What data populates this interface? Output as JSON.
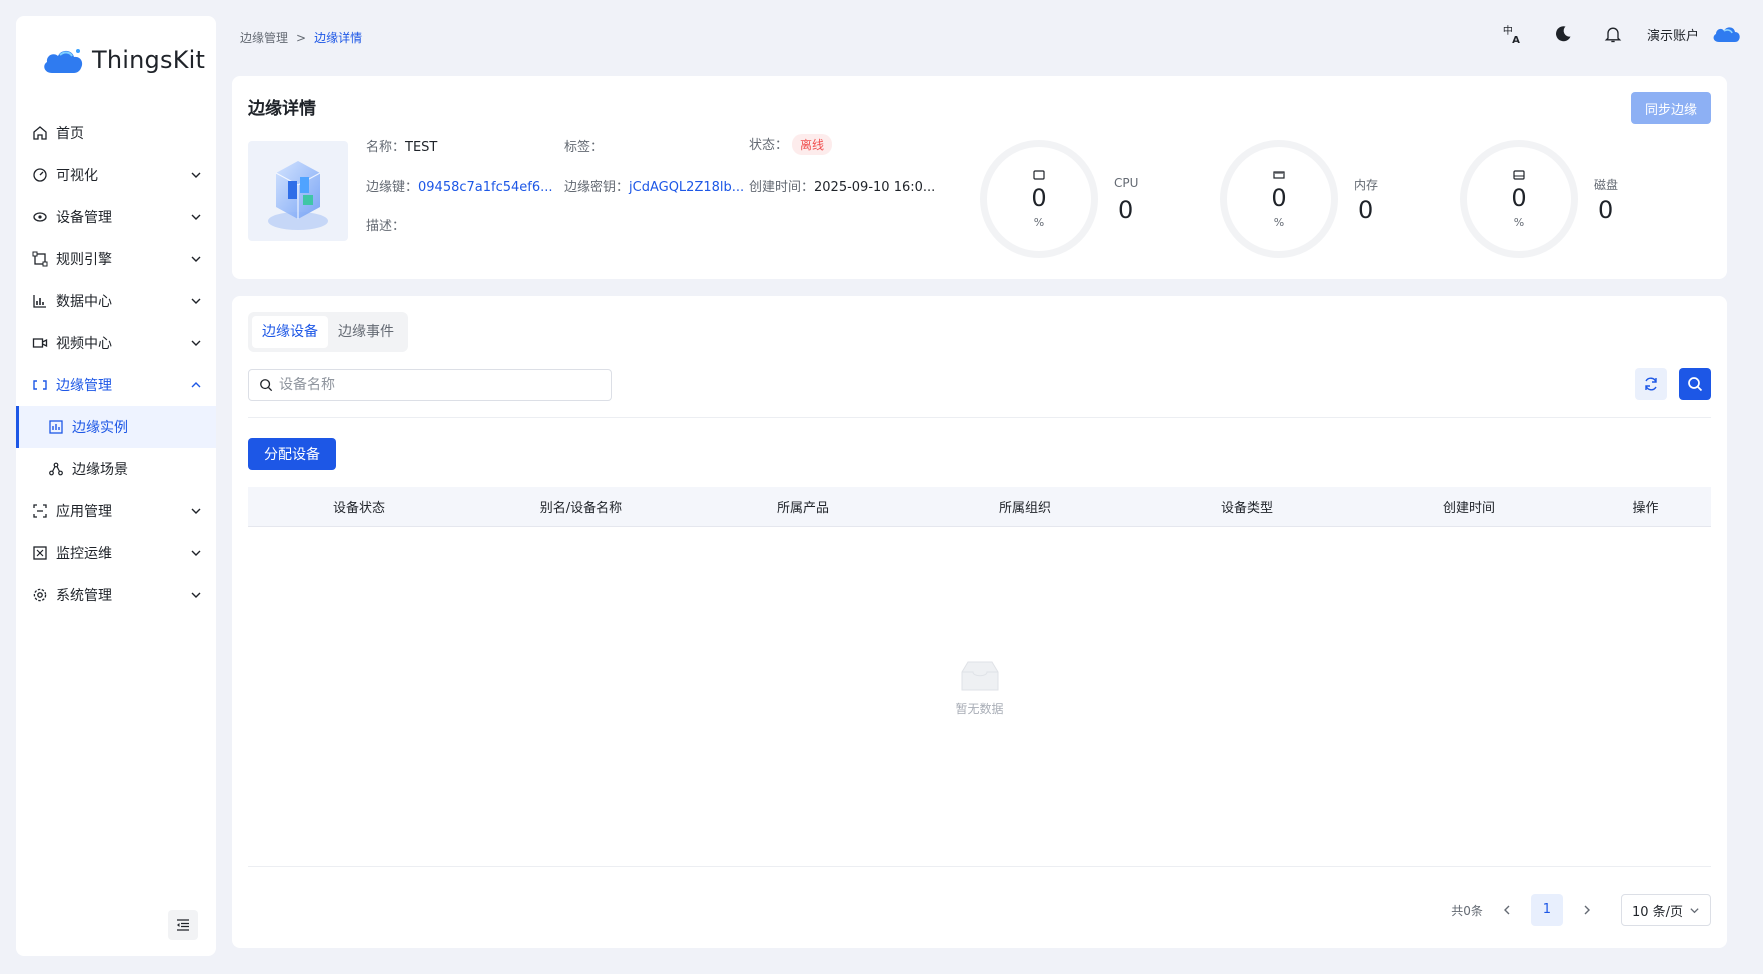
{
  "app": {
    "name": "ThingsKit"
  },
  "sidebar": {
    "items": [
      {
        "label": "首页"
      },
      {
        "label": "可视化"
      },
      {
        "label": "设备管理"
      },
      {
        "label": "规则引擎"
      },
      {
        "label": "数据中心"
      },
      {
        "label": "视频中心"
      },
      {
        "label": "边缘管理"
      },
      {
        "label": "边缘实例"
      },
      {
        "label": "边缘场景"
      },
      {
        "label": "应用管理"
      },
      {
        "label": "监控运维"
      },
      {
        "label": "系统管理"
      }
    ]
  },
  "breadcrumb": {
    "parent": "边缘管理",
    "separator": ">",
    "current": "边缘详情"
  },
  "header": {
    "account": "演示账户"
  },
  "detail": {
    "title": "边缘详情",
    "sync_label": "同步边缘",
    "name_label": "名称：",
    "name_value": "TEST",
    "tag_label": "标签：",
    "status_label": "状态：",
    "status_value": "离线",
    "key_label": "边缘键：",
    "key_value": "09458c7a1fc54ef6...",
    "secret_label": "边缘密钥：",
    "secret_value": "jCdAGQL2Z18lb...",
    "created_label": "创建时间：",
    "created_value": "2025-09-10 16:0...",
    "desc_label": "描述：",
    "stats": [
      {
        "ring_value": "0",
        "unit": "%",
        "label": "CPU",
        "value": "0"
      },
      {
        "ring_value": "0",
        "unit": "%",
        "label": "内存",
        "value": "0"
      },
      {
        "ring_value": "0",
        "unit": "%",
        "label": "磁盘",
        "value": "0"
      }
    ]
  },
  "main": {
    "tabs": [
      {
        "label": "边缘设备"
      },
      {
        "label": "边缘事件"
      }
    ],
    "search": {
      "placeholder": "设备名称"
    },
    "assign_label": "分配设备",
    "columns": [
      "设备状态",
      "别名/设备名称",
      "所属产品",
      "所属组织",
      "设备类型",
      "创建时间",
      "操作"
    ],
    "empty_text": "暂无数据",
    "pagination": {
      "total": "共0条",
      "page": "1",
      "page_size": "10 条/页"
    }
  },
  "colors": {
    "primary": "#1d57e6",
    "offline": "#f05050",
    "background": "#f0f2f8"
  }
}
